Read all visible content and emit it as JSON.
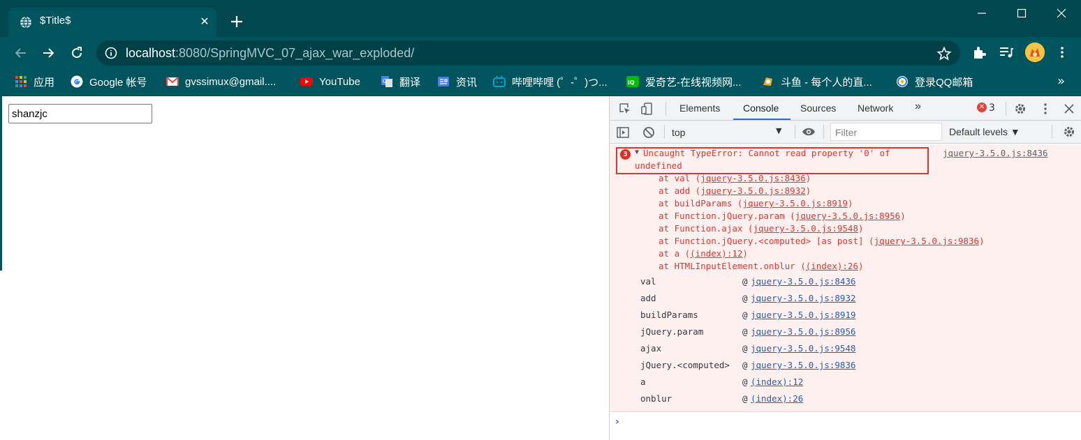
{
  "window": {
    "tab_title": "$Title$",
    "tab_close": "✕"
  },
  "toolbar": {
    "url_host": "localhost",
    "url_rest": ":8080/SpringMVC_07_ajax_war_exploded/"
  },
  "bookmarks": {
    "items": [
      {
        "label": "应用",
        "color": "#e8453c"
      },
      {
        "label": "Google 帐号",
        "color": "#4285f4"
      },
      {
        "label": "gvssimux@gmail....",
        "color": "#ea4335"
      },
      {
        "label": "YouTube",
        "color": "#ff0000"
      },
      {
        "label": "翻译",
        "color": "#4285f4"
      },
      {
        "label": "资讯",
        "color": "#4a7de8"
      },
      {
        "label": "哔哩哔哩 (゜-゜)つ...",
        "color": "#00a1d6"
      },
      {
        "label": "爱奇艺-在线视频网...",
        "color": "#00be06"
      },
      {
        "label": "斗鱼 - 每个人的直...",
        "color": "#f5a623"
      },
      {
        "label": "登录QQ邮箱",
        "color": "#2b7de9"
      }
    ],
    "more": "»"
  },
  "page": {
    "input_value": "shanzjc"
  },
  "devtools": {
    "tabs": [
      "Elements",
      "Console",
      "Sources",
      "Network"
    ],
    "more_tabs": "»",
    "error_count": "3",
    "context": "top",
    "filter_placeholder": "Filter",
    "levels": "Default levels ▼",
    "error": {
      "count_badge": "3",
      "line1": "Uncaught TypeError: Cannot read property '0' of",
      "line2": "undefined",
      "source": "jquery-3.5.0.js:8436",
      "stack": [
        {
          "prefix": "at val (",
          "link": "jquery-3.5.0.js:8436",
          "suffix": ")"
        },
        {
          "prefix": "at add (",
          "link": "jquery-3.5.0.js:8932",
          "suffix": ")"
        },
        {
          "prefix": "at buildParams (",
          "link": "jquery-3.5.0.js:8919",
          "suffix": ")"
        },
        {
          "prefix": "at Function.jQuery.param (",
          "link": "jquery-3.5.0.js:8956",
          "suffix": ")"
        },
        {
          "prefix": "at Function.ajax (",
          "link": "jquery-3.5.0.js:9548",
          "suffix": ")"
        },
        {
          "prefix": "at Function.jQuery.<computed> [as post] (",
          "link": "jquery-3.5.0.js:9836",
          "suffix": ")"
        },
        {
          "prefix": "at a (",
          "link": "(index):12",
          "suffix": ")"
        },
        {
          "prefix": "at HTMLInputElement.onblur (",
          "link": "(index):26",
          "suffix": ")"
        }
      ],
      "frames": [
        {
          "fn": "val",
          "src": "jquery-3.5.0.js:8436"
        },
        {
          "fn": "add",
          "src": "jquery-3.5.0.js:8932"
        },
        {
          "fn": "buildParams",
          "src": "jquery-3.5.0.js:8919"
        },
        {
          "fn": "jQuery.param",
          "src": "jquery-3.5.0.js:8956"
        },
        {
          "fn": "ajax",
          "src": "jquery-3.5.0.js:9548"
        },
        {
          "fn": "jQuery.<computed>",
          "src": "jquery-3.5.0.js:9836"
        },
        {
          "fn": "a",
          "src": "(index):12"
        },
        {
          "fn": "onblur",
          "src": "(index):26"
        }
      ],
      "at_symbol": "@"
    },
    "prompt": "›"
  }
}
